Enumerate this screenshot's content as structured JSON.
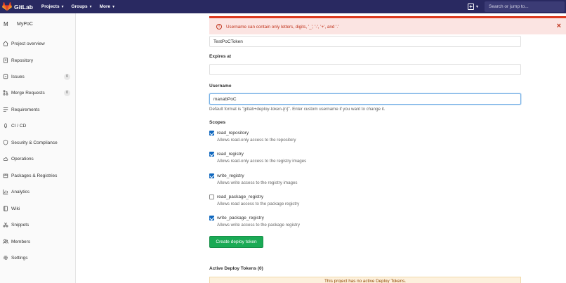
{
  "navbar": {
    "brand": "GitLab",
    "menu": [
      {
        "label": "Projects"
      },
      {
        "label": "Groups"
      },
      {
        "label": "More"
      }
    ],
    "search_placeholder": "Search or jump to..."
  },
  "sidebar": {
    "avatar_letter": "M",
    "project_name": "MyPoC",
    "items": [
      {
        "label": "Project overview",
        "icon": "home-icon"
      },
      {
        "label": "Repository",
        "icon": "doc-icon"
      },
      {
        "label": "Issues",
        "icon": "issues-icon",
        "badge": "0"
      },
      {
        "label": "Merge Requests",
        "icon": "merge-icon",
        "badge": "0"
      },
      {
        "label": "Requirements",
        "icon": "list-icon"
      },
      {
        "label": "CI / CD",
        "icon": "rocket-icon"
      },
      {
        "label": "Security & Compliance",
        "icon": "shield-icon"
      },
      {
        "label": "Operations",
        "icon": "cloud-icon"
      },
      {
        "label": "Packages & Registries",
        "icon": "package-icon"
      },
      {
        "label": "Analytics",
        "icon": "chart-icon"
      },
      {
        "label": "Wiki",
        "icon": "book-icon"
      },
      {
        "label": "Snippets",
        "icon": "scissors-icon"
      },
      {
        "label": "Members",
        "icon": "users-icon"
      },
      {
        "label": "Settings",
        "icon": "gear-icon"
      }
    ]
  },
  "flash": {
    "message": "Username can contain only letters, digits, '_', '-', '+', and '.'"
  },
  "form": {
    "name_value": "TestPoCToken",
    "expires_label": "Expires at",
    "expires_value": "",
    "username_label": "Username",
    "username_value": "manabPoC",
    "username_help": "Default format is \"gitlab+deploy-token-{n}\". Enter custom username if you want to change it.",
    "scopes_label": "Scopes",
    "scopes": [
      {
        "name": "read_repository",
        "desc": "Allows read-only access to the repository",
        "checked": true
      },
      {
        "name": "read_registry",
        "desc": "Allows read-only access to the registry images",
        "checked": true
      },
      {
        "name": "write_registry",
        "desc": "Allows write access to the registry images",
        "checked": true
      },
      {
        "name": "read_package_registry",
        "desc": "Allows read access to the package registry",
        "checked": false
      },
      {
        "name": "write_package_registry",
        "desc": "Allows write access to the package registry",
        "checked": true
      }
    ],
    "create_button": "Create deploy token"
  },
  "active_tokens": {
    "title": "Active Deploy Tokens (0)",
    "empty_message": "This project has no active Deploy Tokens."
  },
  "colors": {
    "navbar": "#292961",
    "danger": "#db3b21",
    "success": "#1aaa55",
    "checkbox": "#1068bf"
  }
}
